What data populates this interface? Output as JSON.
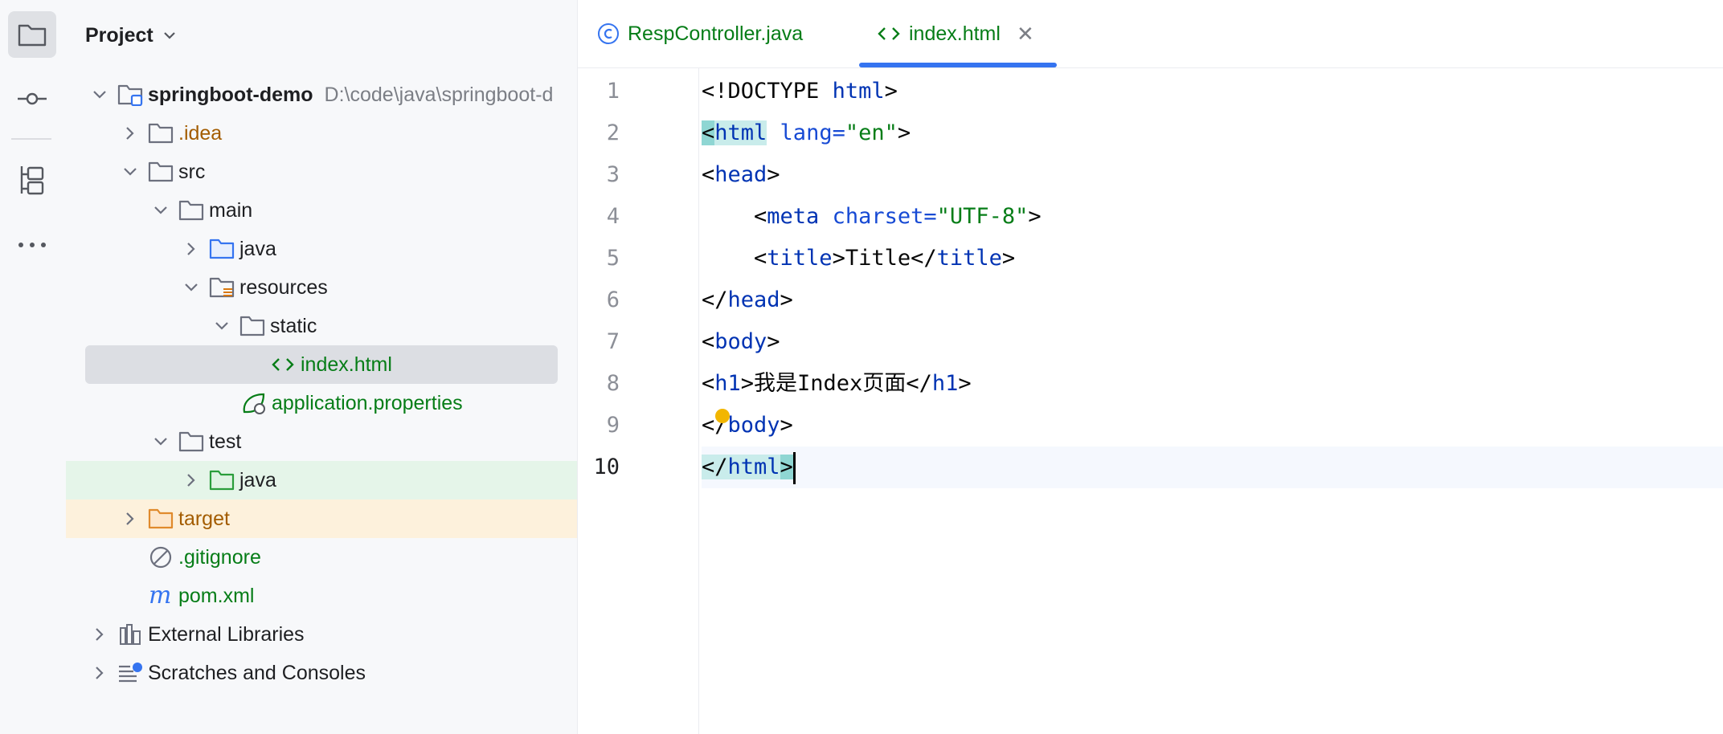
{
  "toolbar": {
    "items": [
      {
        "name": "project",
        "icon": "folder-icon"
      },
      {
        "name": "commit",
        "icon": "commit-icon"
      },
      {
        "name": "structure",
        "icon": "structure-icon"
      },
      {
        "name": "more",
        "icon": "more-icon"
      }
    ]
  },
  "project_panel": {
    "title": "Project",
    "tree": [
      {
        "label": "springboot-demo",
        "path": "D:\\code\\java\\springboot-d"
      },
      {
        "label": ".idea"
      },
      {
        "label": "src"
      },
      {
        "label": "main"
      },
      {
        "label": "java"
      },
      {
        "label": "resources"
      },
      {
        "label": "static"
      },
      {
        "label": "index.html"
      },
      {
        "label": "application.properties"
      },
      {
        "label": "test"
      },
      {
        "label": "java"
      },
      {
        "label": "target"
      },
      {
        "label": ".gitignore"
      },
      {
        "label": "pom.xml"
      },
      {
        "label": "External Libraries"
      },
      {
        "label": "Scratches and Consoles"
      }
    ]
  },
  "editor": {
    "tabs": [
      {
        "label": "RespController.java"
      },
      {
        "label": "index.html",
        "active": true
      }
    ],
    "line_numbers": [
      "1",
      "2",
      "3",
      "4",
      "5",
      "6",
      "7",
      "8",
      "9",
      "10"
    ],
    "lines": {
      "l1a": "<!DOCTYPE ",
      "l1b": "html",
      "l1c": ">",
      "l2a": "<",
      "l2b": "html",
      "l2c": " lang=",
      "l2d": "\"en\"",
      "l2e": ">",
      "l3a": "<",
      "l3b": "head",
      "l3c": ">",
      "l4a": "    <",
      "l4b": "meta",
      "l4c": " charset=",
      "l4d": "\"UTF-8\"",
      "l4e": ">",
      "l5a": "    <",
      "l5b": "title",
      "l5c": ">Title</",
      "l5d": "title",
      "l5e": ">",
      "l6a": "</",
      "l6b": "head",
      "l6c": ">",
      "l7a": "<",
      "l7b": "body",
      "l7c": ">",
      "l8a": "<",
      "l8b": "h1",
      "l8c": ">我是Index页面</",
      "l8d": "h1",
      "l8e": ">",
      "l9a": "</",
      "l9b": "body",
      "l9c": ">",
      "l10a": "</",
      "l10b": "html",
      "l10c": ">"
    }
  },
  "colors": {
    "accent": "#3574f0",
    "selection": "#dcdee3",
    "test_bg": "#e5f5e9",
    "excluded_bg": "#fdf1dc",
    "tag": "#0033b3",
    "string": "#067d17"
  }
}
